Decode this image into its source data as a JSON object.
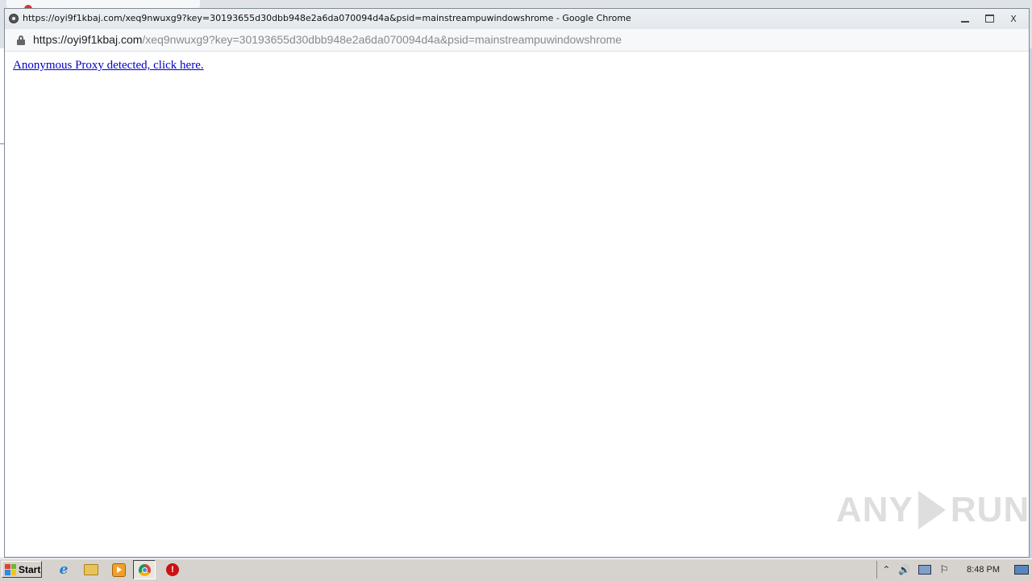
{
  "window": {
    "title": "https://oyi9f1kbaj.com/xeq9nwuxg9?key=30193655d30dbb948e2a6da070094d4a&psid=mainstreampuwindowshrome - Google Chrome",
    "controls": [
      "minimize",
      "maximize",
      "close"
    ],
    "close_glyph": "X"
  },
  "address_bar": {
    "domain": "https://oyi9f1kbaj.com",
    "path": "/xeq9nwuxg9?key=30193655d30dbb948e2a6da070094d4a&psid=mainstreampuwindowshrome"
  },
  "page": {
    "link_text": "Anonymous Proxy detected, click here."
  },
  "watermark": {
    "left": "ANY",
    "right": "RUN"
  },
  "taskbar": {
    "start_label": "Start",
    "clock": "8:48 PM",
    "tray_arrow": "⌃",
    "tray_volume": "🔊",
    "tray_flag": "⚐"
  },
  "colors": {
    "link": "#0000cc",
    "taskbar": "#d6d3ce"
  }
}
